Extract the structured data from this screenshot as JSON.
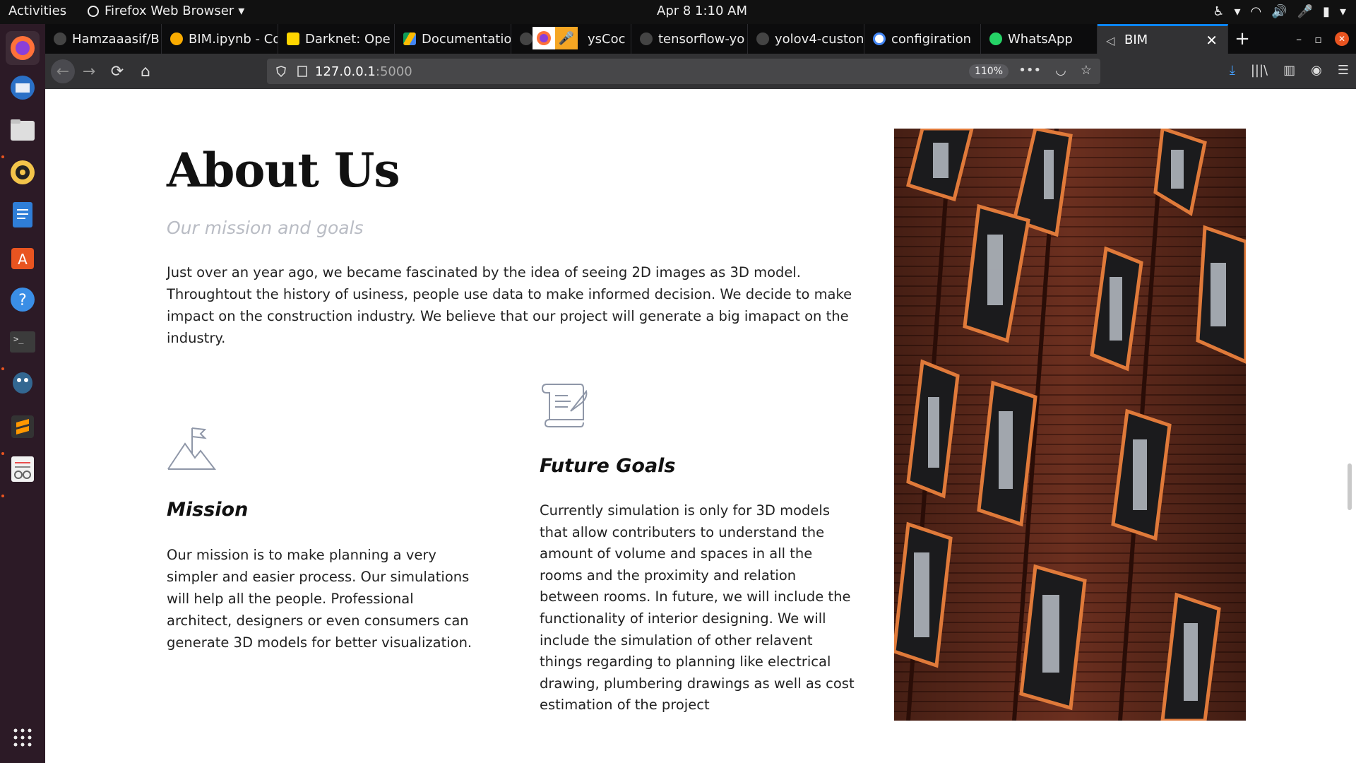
{
  "system_bar": {
    "activities": "Activities",
    "app_name": "Firefox Web Browser",
    "clock": "Apr 8  1:10 AM"
  },
  "dock": {
    "items": [
      "firefox-icon",
      "thunderbird-icon",
      "files-icon",
      "rhythmbox-icon",
      "writer-icon",
      "software-center-icon",
      "help-icon",
      "terminal-icon",
      "postgres-icon",
      "sublime-icon",
      "text-editor-icon"
    ]
  },
  "tabs": [
    {
      "title": "Hamzaaasif/B",
      "icon": "github-icon"
    },
    {
      "title": "BIM.ipynb - Co",
      "icon": "colab-icon"
    },
    {
      "title": "Darknet: Ope",
      "icon": "darknet-icon"
    },
    {
      "title": "Documentatio",
      "icon": "drive-icon"
    },
    {
      "title": "ysCoc",
      "icon": "github-icon"
    },
    {
      "title": "tensorflow-yo",
      "icon": "github-icon"
    },
    {
      "title": "yolov4-custon",
      "icon": "github-icon"
    },
    {
      "title": "configiration",
      "icon": "google-icon"
    },
    {
      "title": "WhatsApp",
      "icon": "whatsapp-icon"
    },
    {
      "title": "BIM",
      "icon": "page-icon",
      "active": true
    }
  ],
  "navbar": {
    "url_host": "127.0.0.1",
    "url_port": ":5000",
    "zoom": "110%"
  },
  "content": {
    "title": "About Us",
    "subtitle": "Our mission and goals",
    "intro": "Just over an year ago, we became fascinated by the idea of seeing 2D images as 3D model. Throughtout the history of usiness, people use data to make informed decision. We decide to make impact on the construction industry. We believe that our project will generate a big imapact on the industry.",
    "mission": {
      "heading": "Mission",
      "text": "Our mission is to make planning a very simpler and easier process. Our simulations will help all the people. Professional architect, designers or even consumers can generate 3D models for better visualization."
    },
    "goals": {
      "heading": "Future Goals",
      "text": "Currently simulation is only for 3D models that allow contributers to understand the amount of volume and spaces in all the rooms and the proximity and relation between rooms. In future, we will include the functionality of interior designing. We will include the simulation of other relavent things regarding to planning like electrical drawing, plumbering drawings as well as cost estimation of the project"
    }
  },
  "colors": {
    "subtitle": "#b9bcc4",
    "accent_tab": "#0a84ff",
    "dock_bg": "#2c1a26"
  }
}
